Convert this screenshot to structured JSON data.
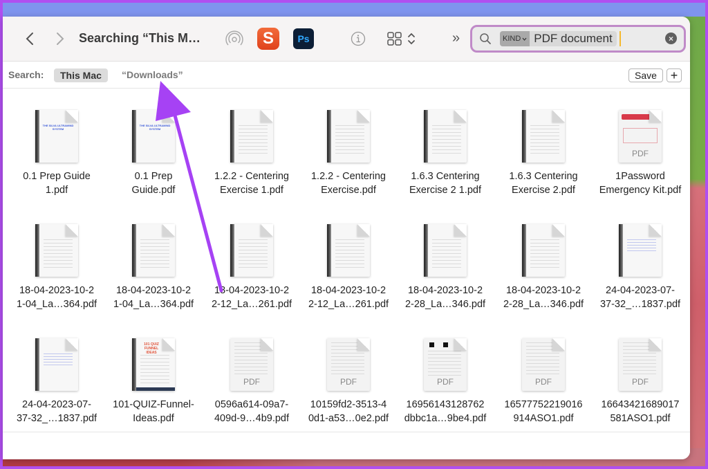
{
  "window": {
    "title": "Searching “This M…"
  },
  "toolbar": {
    "back_icon": "chevron-left-icon",
    "forward_icon": "chevron-right-icon",
    "airdrop_icon": "airdrop-icon",
    "app_s_label": "S",
    "app_ps_label": "Ps",
    "info_icon": "info-icon",
    "view_icon": "icon-grid-view-icon",
    "overflow_label": "»"
  },
  "search": {
    "token_kind": "KIND",
    "token_value": "PDF document",
    "clear_label": "×"
  },
  "scope": {
    "label": "Search:",
    "this_mac": "This Mac",
    "downloads": "“Downloads”",
    "save_label": "Save",
    "add_label": "+"
  },
  "files": [
    {
      "name": "0.1 Prep Guide\n1.pdf",
      "thumb": "silva"
    },
    {
      "name": "0.1 Prep\nGuide.pdf",
      "thumb": "silva"
    },
    {
      "name": "1.2.2 - Centering\nExercise 1.pdf",
      "thumb": "bound"
    },
    {
      "name": "1.2.2 - Centering\nExercise.pdf",
      "thumb": "bound"
    },
    {
      "name": "1.6.3 Centering\nExercise 2 1.pdf",
      "thumb": "bound"
    },
    {
      "name": "1.6.3 Centering\nExercise 2.pdf",
      "thumb": "bound"
    },
    {
      "name": "1Password\nEmergency Kit.pdf",
      "thumb": "onepw"
    },
    {
      "name": "18-04-2023-10-2\n1-04_La…364.pdf",
      "thumb": "bound"
    },
    {
      "name": "18-04-2023-10-2\n1-04_La…364.pdf",
      "thumb": "bound"
    },
    {
      "name": "18-04-2023-10-2\n2-12_La…261.pdf",
      "thumb": "bound"
    },
    {
      "name": "18-04-2023-10-2\n2-12_La…261.pdf",
      "thumb": "bound"
    },
    {
      "name": "18-04-2023-10-2\n2-28_La…346.pdf",
      "thumb": "bound"
    },
    {
      "name": "18-04-2023-10-2\n2-28_La…346.pdf",
      "thumb": "bound"
    },
    {
      "name": "24-04-2023-07-\n37-32_…1837.pdf",
      "thumb": "blue"
    },
    {
      "name": "24-04-2023-07-\n37-32_…1837.pdf",
      "thumb": "blue"
    },
    {
      "name": "101-QUIZ-Funnel-\nIdeas.pdf",
      "thumb": "quiz"
    },
    {
      "name": "0596a614-09a7-\n409d-9…4b9.pdf",
      "thumb": "pdf"
    },
    {
      "name": "10159fd2-3513-4\n0d1-a53…0e2.pdf",
      "thumb": "pdf"
    },
    {
      "name": "16956143128762\ndbbc1a…9be4.pdf",
      "thumb": "pdfsq"
    },
    {
      "name": "16577752219016\n914ASO1.pdf",
      "thumb": "pdf"
    },
    {
      "name": "16643421689017\n581ASO1.pdf",
      "thumb": "pdf"
    }
  ],
  "thumb_text": {
    "silva": "THE\nSILVA ULTRAMIND\nSYSTEM",
    "quiz": "101 QUIZ\nFUNNEL IDEAS",
    "pdf": "PDF"
  },
  "colors": {
    "search_focus_ring": "#c08ac8",
    "annotation_arrow": "#a642f4",
    "caret": "#f5b82e"
  }
}
